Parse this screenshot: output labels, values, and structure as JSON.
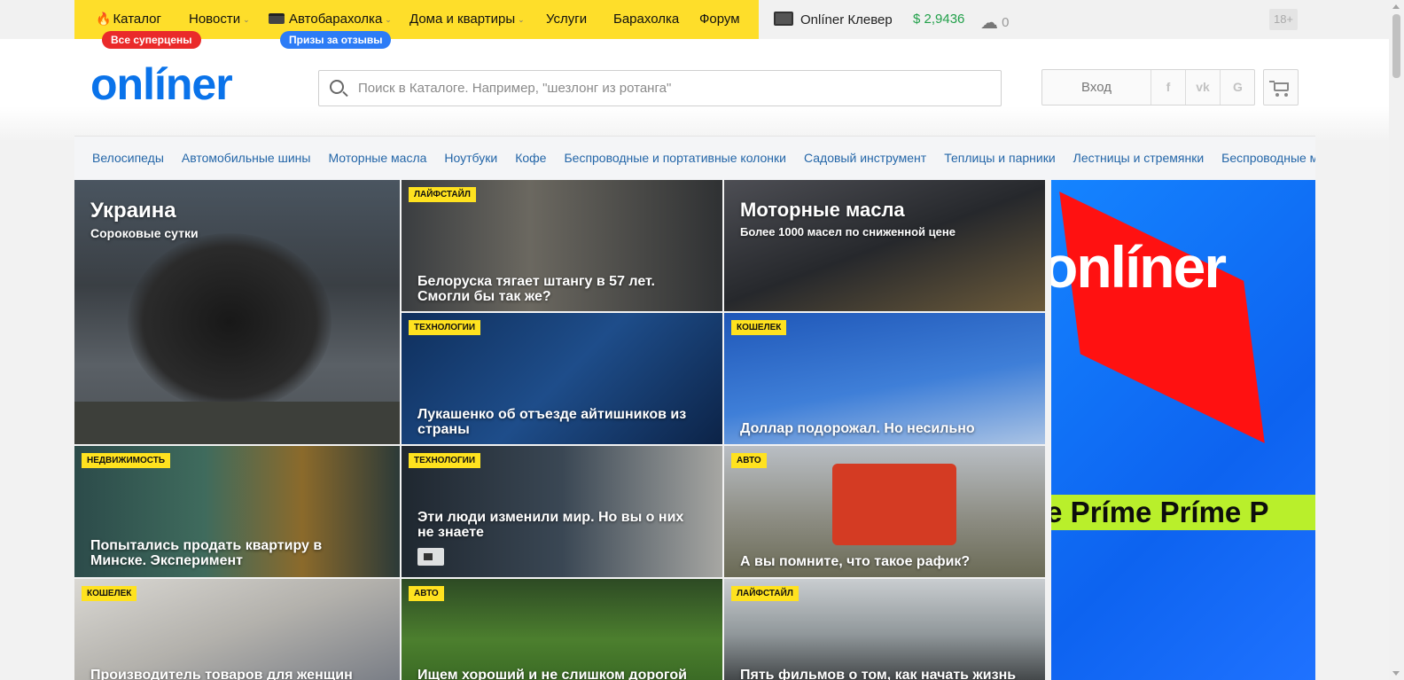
{
  "topnav": {
    "items": [
      {
        "label": "Каталог",
        "has_chevron": false
      },
      {
        "label": "Новости",
        "has_chevron": true
      },
      {
        "label": "Автобарахолка",
        "has_chevron": true
      },
      {
        "label": "Дома и квартиры",
        "has_chevron": true
      },
      {
        "label": "Услуги",
        "has_chevron": false
      },
      {
        "label": "Барахолка",
        "has_chevron": false
      },
      {
        "label": "Форум",
        "has_chevron": false
      }
    ],
    "promo_red": "Все суперцены",
    "promo_blue": "Призы за отзывы",
    "clever": "Onlíner Клевер",
    "currency": "$ 2,9436",
    "weather": "0",
    "age": "18+",
    "accent_color": "#fede2a"
  },
  "header": {
    "logo": "onlíner",
    "search_placeholder": "Поиск в Каталоге. Например, \"шезлонг из ротанга\"",
    "login": "Вход",
    "social": [
      "f",
      "vk",
      "G"
    ]
  },
  "quick_links": [
    "Велосипеды",
    "Автомобильные шины",
    "Моторные масла",
    "Ноутбуки",
    "Кофе",
    "Беспроводные и портативные колонки",
    "Садовый инструмент",
    "Теплицы и парники",
    "Лестницы и стремянки",
    "Беспроводные ма"
  ],
  "news": {
    "big": {
      "title": "Украина",
      "subtitle": "Сороковые сутки"
    },
    "promo": {
      "title": "Моторные масла",
      "subtitle": "Более 1000 масел по сниженной цене"
    },
    "items": [
      {
        "tag": "Лайфстайл",
        "title": "Белоруска тягает штангу в 57 лет. Смогли бы так же?"
      },
      {
        "tag": "Технологии",
        "title": "Лукашенко об отъезде айтишников из страны"
      },
      {
        "tag": "Кошелек",
        "title": "Доллар подорожал. Но несильно"
      },
      {
        "tag": "Недвижимость",
        "title": "Попытались продать квартиру в Минске. Эксперимент"
      },
      {
        "tag": "Технологии",
        "title": "Эти люди изменили мир. Но вы о них не знаете"
      },
      {
        "tag": "Авто",
        "title": "А вы помните, что такое рафик?"
      },
      {
        "tag": "Кошелек",
        "title": "Производитель товаров для женщин"
      },
      {
        "tag": "Авто",
        "title": "Ищем хороший и не слишком дорогой"
      },
      {
        "tag": "Лайфстайл",
        "title": "Пять фильмов о том, как начать жизнь с"
      }
    ]
  },
  "ad": {
    "word": "onlíner",
    "strip": "ne Príme Príme P"
  }
}
